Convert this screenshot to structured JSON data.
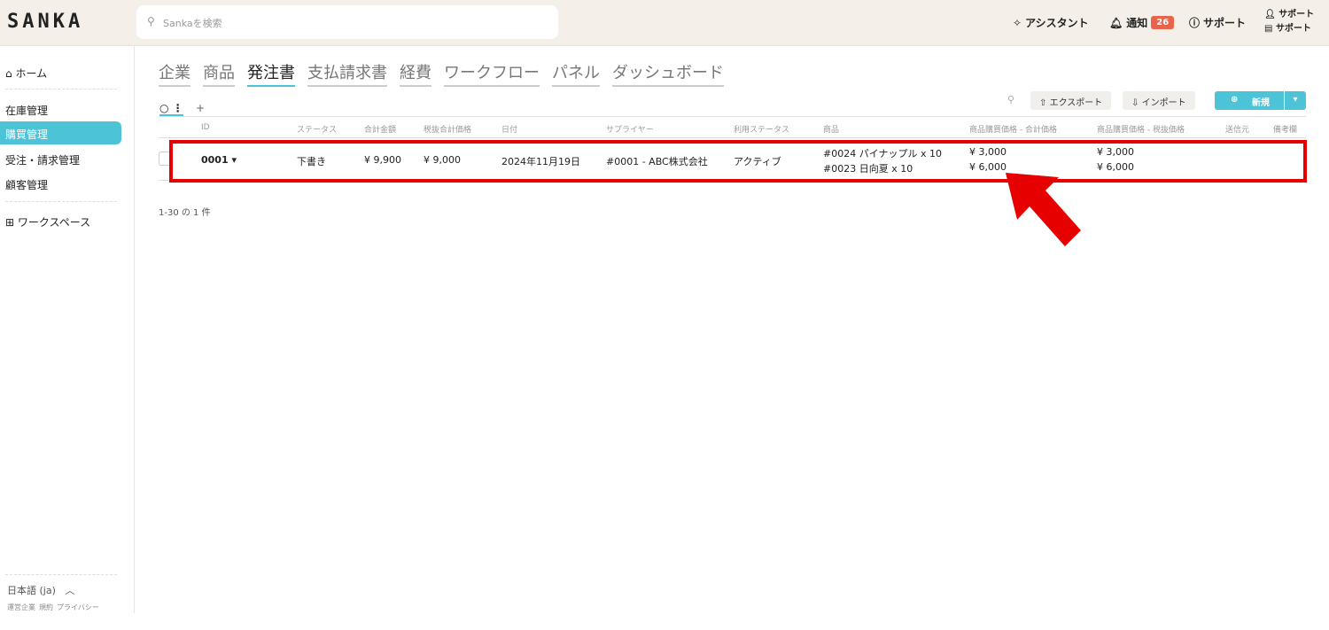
{
  "header": {
    "logo": "SANKA",
    "search_placeholder": "Sankaを検索",
    "assistant": "アシスタント",
    "notifications": "通知",
    "notif_count": "26",
    "support": "サポート",
    "user_line1": "サポート",
    "user_line2": "サポート"
  },
  "sidebar": {
    "home": "ホーム",
    "items": [
      {
        "label": "在庫管理"
      },
      {
        "label": "購買管理"
      },
      {
        "label": "受注・請求管理"
      },
      {
        "label": "顧客管理"
      }
    ],
    "workspace": "ワークスペース",
    "language": "日本語 (ja)",
    "footer": [
      "運営企業",
      "規約",
      "プライバシー"
    ]
  },
  "tabs": [
    {
      "label": "企業"
    },
    {
      "label": "商品"
    },
    {
      "label": "発注書"
    },
    {
      "label": "支払請求書"
    },
    {
      "label": "経費"
    },
    {
      "label": "ワークフロー"
    },
    {
      "label": "パネル"
    },
    {
      "label": "ダッシュボード"
    }
  ],
  "toolbar": {
    "export": "エクスポート",
    "import": "インポート",
    "new": "新規"
  },
  "table": {
    "headers": [
      "ID",
      "ステータス",
      "合計金額",
      "税抜合計価格",
      "日付",
      "サプライヤー",
      "利用ステータス",
      "商品",
      "商品購買価格 - 合計価格",
      "商品購買価格 - 税抜価格",
      "送信元",
      "備考欄"
    ],
    "row": {
      "id": "0001",
      "status": "下書き",
      "total": "¥ 9,900",
      "subtotal": "¥ 9,000",
      "date": "2024年11月19日",
      "supplier": "#0001 - ABC株式会社",
      "usage": "アクティブ",
      "items": [
        "#0024 パイナップル x 10",
        "#0023 日向夏 x 10"
      ],
      "price_total": [
        "¥ 3,000",
        "¥ 6,000"
      ],
      "price_net": [
        "¥ 3,000",
        "¥ 6,000"
      ]
    }
  },
  "pagination": "1-30 の 1 件",
  "colors": {
    "accent": "#4cc3d6",
    "annotation": "#e60000",
    "badge": "#e8634a"
  }
}
